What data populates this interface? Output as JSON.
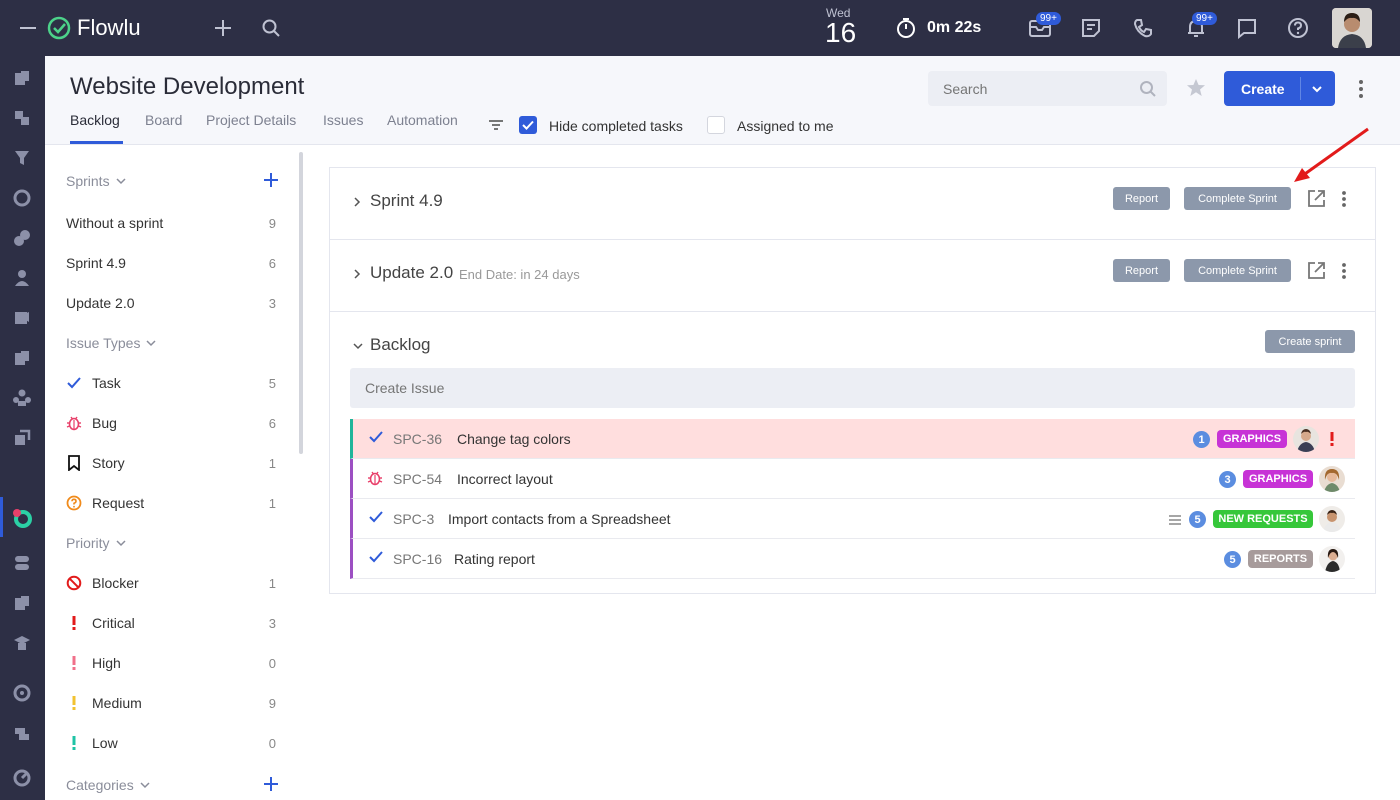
{
  "topbar": {
    "logo": "Flowlu",
    "day_name": "Wed",
    "day_num": "16",
    "timer": "0m 22s",
    "mail_badge": "99+",
    "bell_badge": "99+"
  },
  "header": {
    "title": "Website Development",
    "tabs": [
      "Backlog",
      "Board",
      "Project Details",
      "Issues",
      "Automation"
    ],
    "hide_completed": "Hide completed tasks",
    "assigned_to_me": "Assigned to me",
    "search_placeholder": "Search",
    "create_label": "Create"
  },
  "sidebar": {
    "sprints_title": "Sprints",
    "sprints": [
      {
        "label": "Without a sprint",
        "count": "9"
      },
      {
        "label": "Sprint 4.9",
        "count": "6"
      },
      {
        "label": "Update 2.0",
        "count": "3"
      }
    ],
    "issue_types_title": "Issue Types",
    "issue_types": [
      {
        "label": "Task",
        "count": "5"
      },
      {
        "label": "Bug",
        "count": "6"
      },
      {
        "label": "Story",
        "count": "1"
      },
      {
        "label": "Request",
        "count": "1"
      }
    ],
    "priority_title": "Priority",
    "priorities": [
      {
        "label": "Blocker",
        "count": "1"
      },
      {
        "label": "Critical",
        "count": "3"
      },
      {
        "label": "High",
        "count": "0"
      },
      {
        "label": "Medium",
        "count": "9"
      },
      {
        "label": "Low",
        "count": "0"
      }
    ],
    "categories_title": "Categories"
  },
  "main": {
    "sprint1": {
      "name": "Sprint 4.9",
      "report": "Report",
      "complete": "Complete Sprint"
    },
    "sprint2": {
      "name": "Update 2.0",
      "end_date": "End Date: in 24 days",
      "report": "Report",
      "complete": "Complete Sprint"
    },
    "backlog": {
      "title": "Backlog",
      "create_sprint": "Create sprint",
      "create_issue_placeholder": "Create Issue",
      "issues": [
        {
          "key": "SPC-36",
          "title": "Change tag colors",
          "num": "1",
          "tag": "GRAPHICS"
        },
        {
          "key": "SPC-54",
          "title": "Incorrect layout",
          "num": "3",
          "tag": "GRAPHICS"
        },
        {
          "key": "SPC-3",
          "title": "Import contacts from a Spreadsheet",
          "num": "5",
          "tag": "NEW REQUESTS"
        },
        {
          "key": "SPC-16",
          "title": "Rating report",
          "num": "5",
          "tag": "REPORTS"
        }
      ]
    }
  },
  "colors": {
    "topbar_bg": "#2d2f45",
    "accent": "#2f5bd9",
    "tag_graphics": "#c733d6",
    "tag_new_requests": "#36c73a",
    "tag_reports": "#a79b9b",
    "issue_highlight": "#ffdede"
  }
}
